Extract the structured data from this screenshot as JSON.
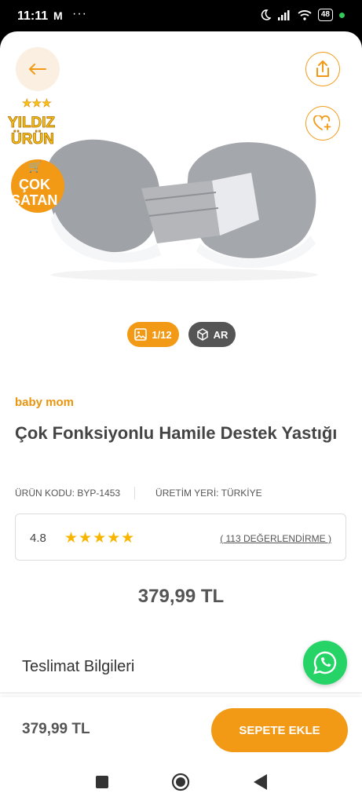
{
  "status_bar": {
    "time": "11:11",
    "mail_glyph": "M",
    "dots": "···",
    "battery": "48"
  },
  "hero": {
    "badges": {
      "star_line1": "YILDIZ",
      "star_line2": "ÜRÜN",
      "cok_line1": "ÇOK",
      "cok_line2": "SATAN"
    },
    "gallery_counter": "1/12",
    "ar_label": "AR"
  },
  "product": {
    "brand": "baby mom",
    "title": "Çok Fonksiyonlu Hamile Destek Yastığı",
    "code": "ÜRÜN KODU: BYP-1453",
    "origin": "ÜRETİM YERİ: TÜRKİYE",
    "rating": "4.8",
    "stars": "★★★★★",
    "reviews": "( 113 DEĞERLENDİRME )",
    "price": "379,99 TL"
  },
  "delivery_title": "Teslimat Bilgileri",
  "bottom_bar": {
    "price": "379,99 TL",
    "cart_button": "SEPETE EKLE"
  },
  "colors": {
    "accent": "#f29a16",
    "whatsapp": "#25d366",
    "star": "#f7b500"
  }
}
